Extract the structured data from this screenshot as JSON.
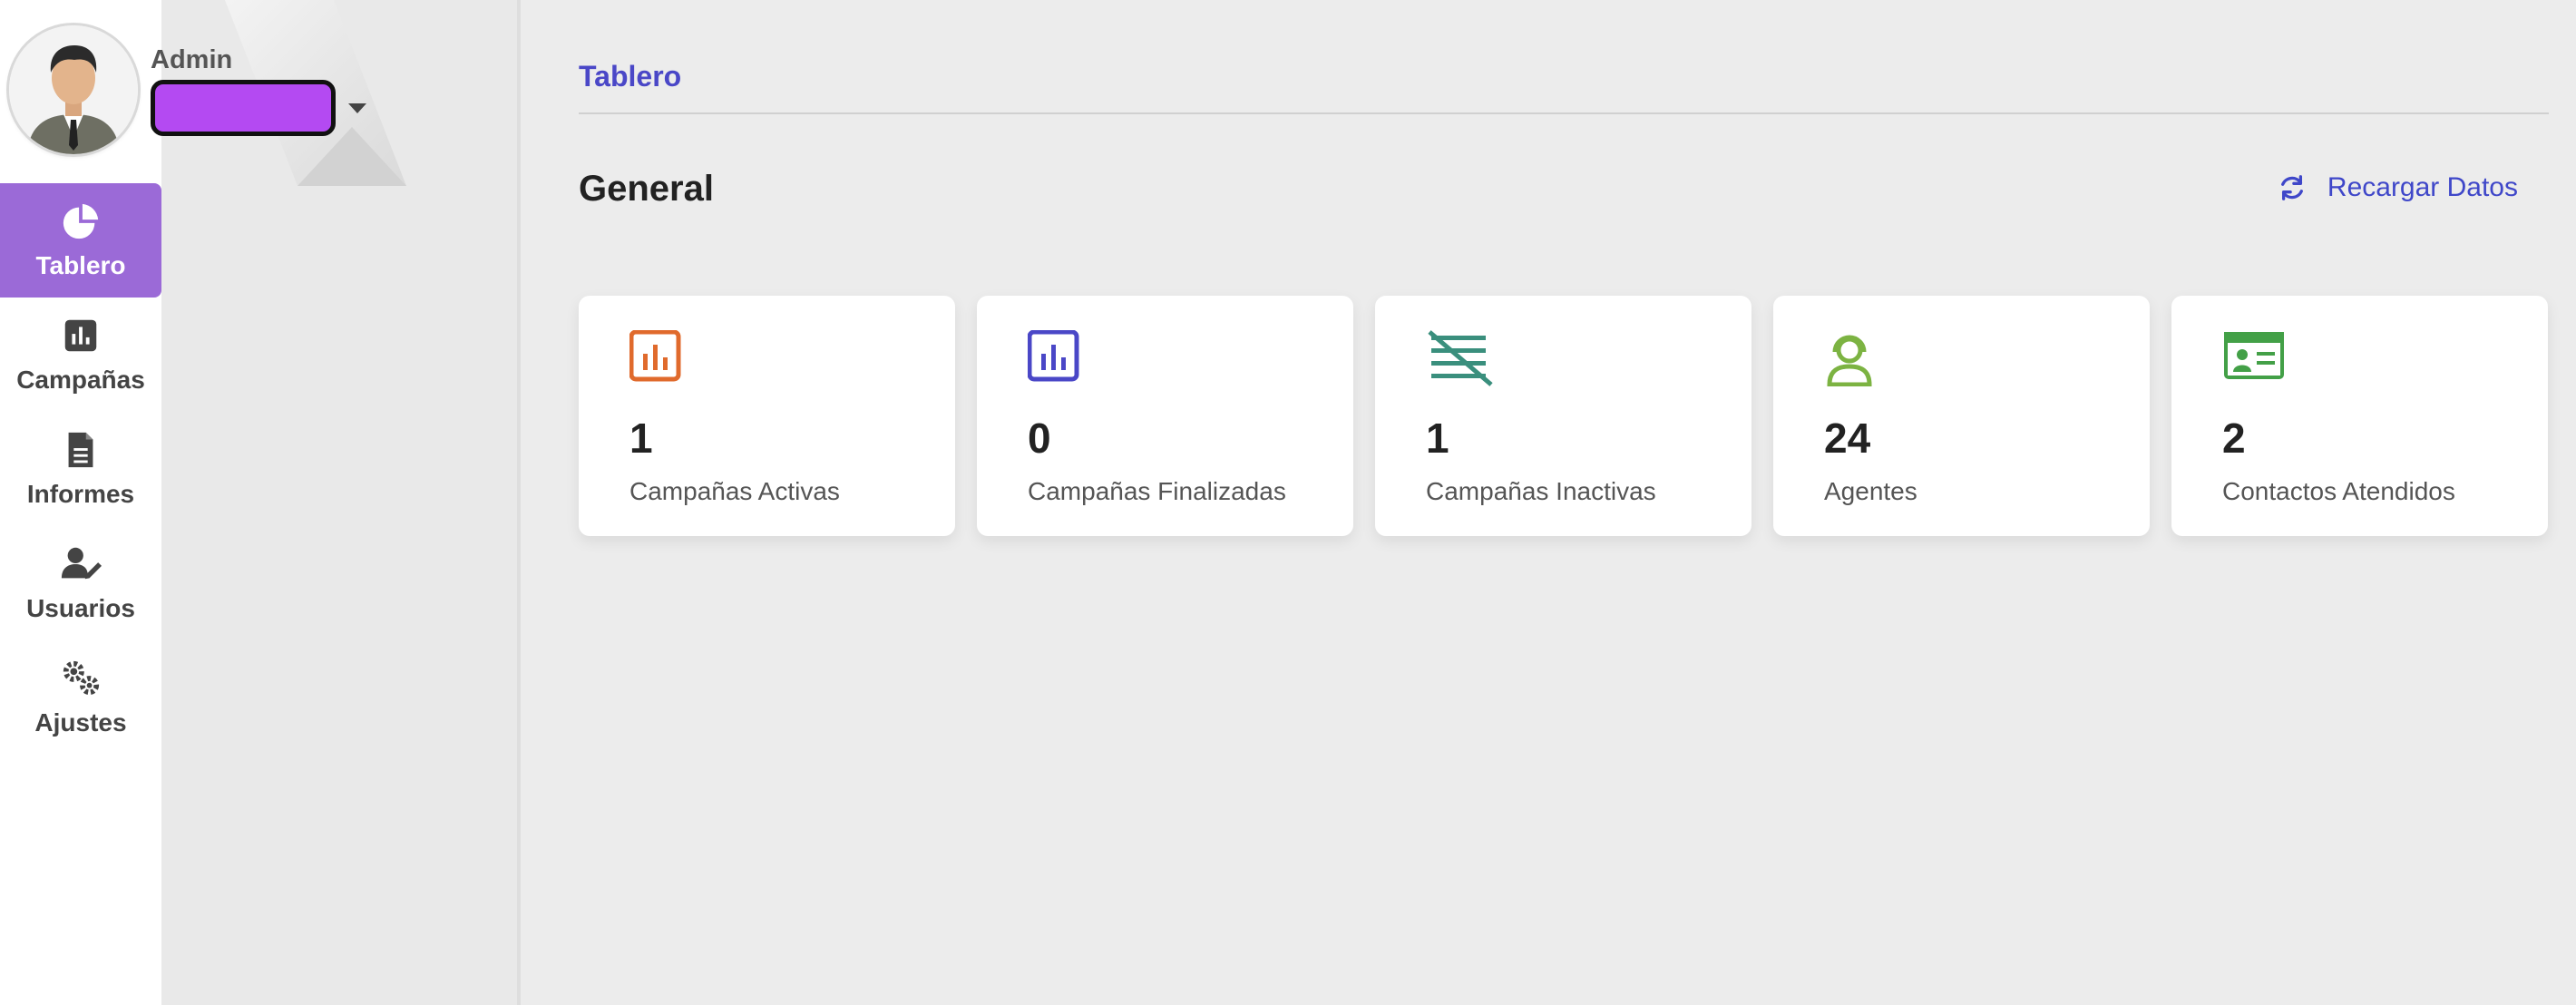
{
  "user": {
    "role": "Admin"
  },
  "nav": [
    {
      "label": "Tablero",
      "icon": "pie-chart-icon",
      "active": true
    },
    {
      "label": "Campañas",
      "icon": "bar-chart-icon",
      "active": false
    },
    {
      "label": "Informes",
      "icon": "document-icon",
      "active": false
    },
    {
      "label": "Usuarios",
      "icon": "user-edit-icon",
      "active": false
    },
    {
      "label": "Ajustes",
      "icon": "gears-icon",
      "active": false
    }
  ],
  "breadcrumb": "Tablero",
  "section": {
    "title": "General",
    "reload_label": "Recargar Datos"
  },
  "stats": [
    {
      "value": "1",
      "label": "Campañas Activas",
      "icon": "bar-chart-icon",
      "color": "#e06a2c"
    },
    {
      "value": "0",
      "label": "Campañas Finalizadas",
      "icon": "bar-chart-icon",
      "color": "#4a47c7"
    },
    {
      "value": "1",
      "label": "Campañas Inactivas",
      "icon": "list-off-icon",
      "color": "#3a8f7d"
    },
    {
      "value": "24",
      "label": "Agentes",
      "icon": "headset-agent-icon",
      "color": "#7cb342"
    },
    {
      "value": "2",
      "label": "Contactos Atendidos",
      "icon": "id-card-icon",
      "color": "#43a047"
    }
  ],
  "colors": {
    "accent": "#9b6ad7",
    "link": "#4a47c7",
    "username_highlight": "#b44af2"
  }
}
